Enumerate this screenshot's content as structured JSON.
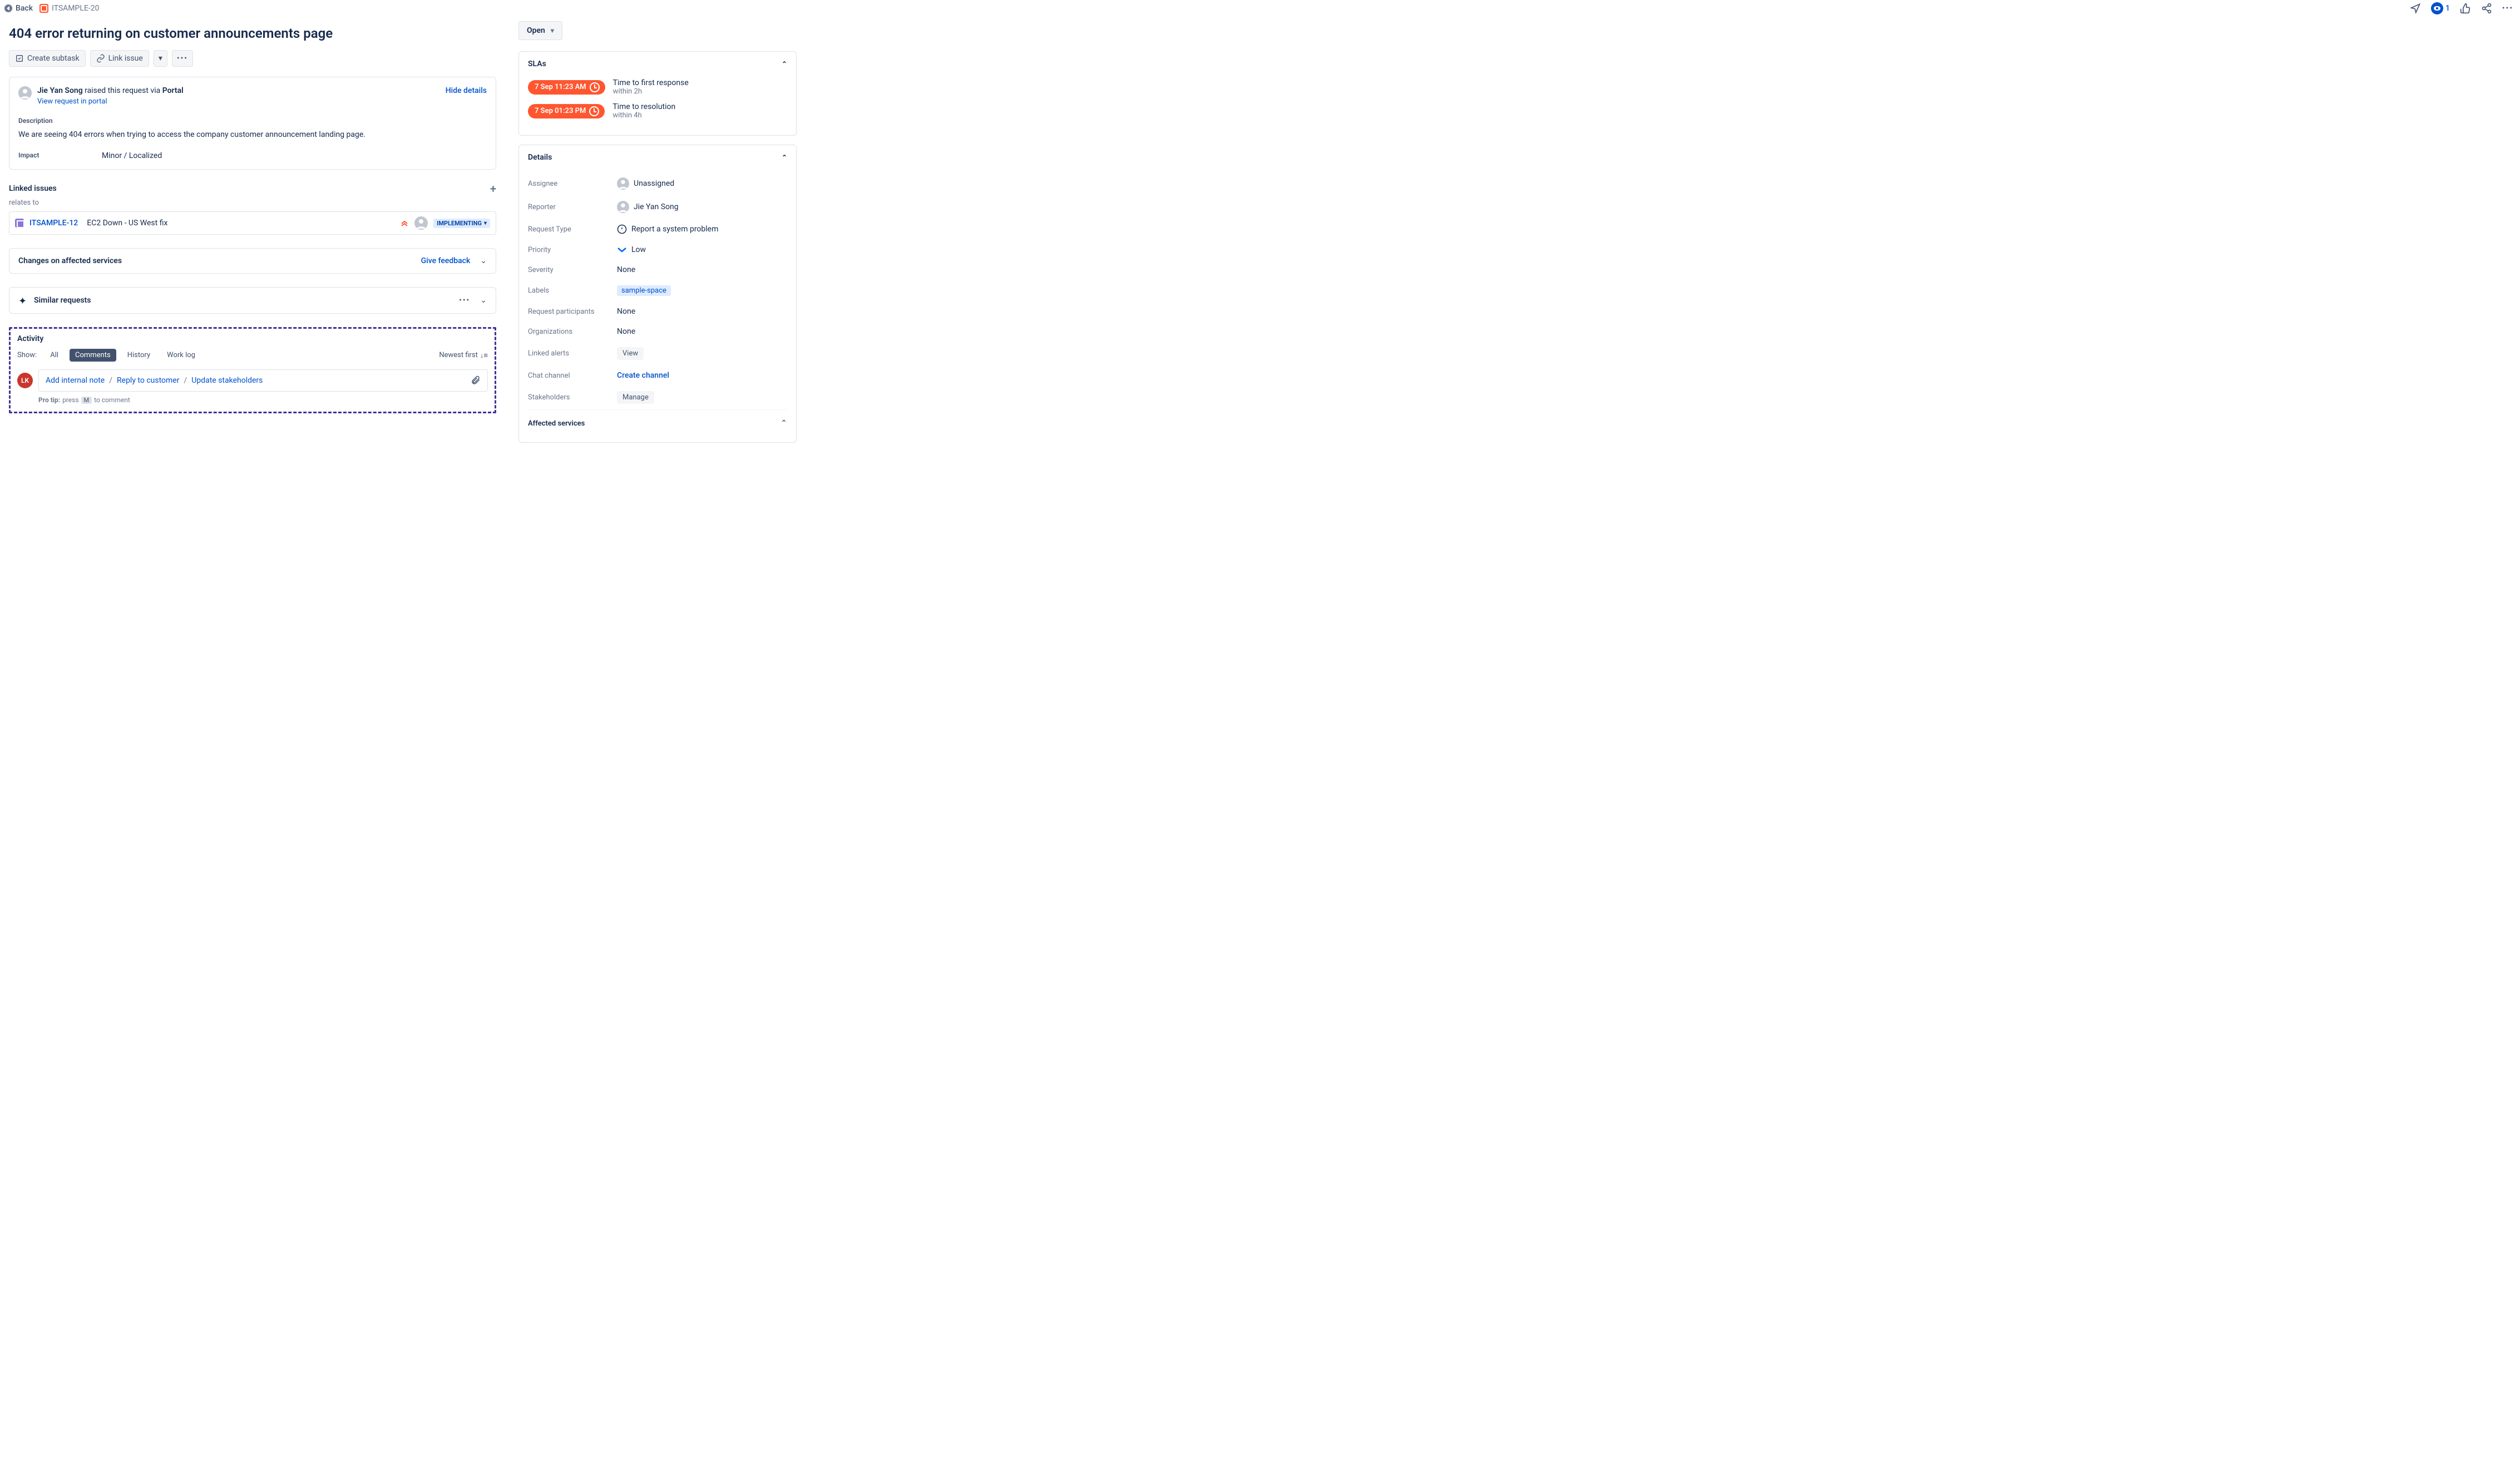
{
  "breadcrumb": {
    "back": "Back",
    "key": "ITSAMPLE-20"
  },
  "topbar": {
    "watch_count": "1"
  },
  "title": "404 error returning on customer announcements page",
  "toolbar": {
    "create_subtask": "Create subtask",
    "link_issue": "Link issue"
  },
  "request": {
    "author": "Jie Yan Song",
    "raised_via_pre": " raised this request via ",
    "raised_via_strong": "Portal",
    "hide_details": "Hide details",
    "view_portal": "View request in portal",
    "desc_label": "Description",
    "desc": "We are seeing 404 errors when trying to access the company customer announcement landing page.",
    "impact_label": "Impact",
    "impact_value": "Minor / Localized"
  },
  "linked": {
    "header": "Linked issues",
    "relation": "relates to",
    "items": [
      {
        "key": "ITSAMPLE-12",
        "title": "EC2 Down - US West fix",
        "status": "IMPLEMENTING"
      }
    ]
  },
  "changes": {
    "title": "Changes on affected services",
    "feedback": "Give feedback"
  },
  "similar": {
    "title": "Similar requests"
  },
  "activity": {
    "header": "Activity",
    "show_label": "Show:",
    "tabs": {
      "all": "All",
      "comments": "Comments",
      "history": "History",
      "worklog": "Work log"
    },
    "sort": "Newest first",
    "user_initials": "LK",
    "add_note": "Add internal note",
    "reply": "Reply to customer",
    "update": "Update stakeholders",
    "protip_label": "Pro tip:",
    "protip_pre": " press ",
    "protip_key": "M",
    "protip_post": " to comment"
  },
  "status": "Open",
  "slas": {
    "header": "SLAs",
    "items": [
      {
        "badge": "7 Sep 11:23 AM",
        "title": "Time to first response",
        "detail": "within 2h"
      },
      {
        "badge": "7 Sep 01:23 PM",
        "title": "Time to resolution",
        "detail": "within 4h"
      }
    ]
  },
  "details": {
    "header": "Details",
    "assignee_label": "Assignee",
    "assignee": "Unassigned",
    "reporter_label": "Reporter",
    "reporter": "Jie Yan Song",
    "reqtype_label": "Request Type",
    "reqtype": "Report a system problem",
    "priority_label": "Priority",
    "priority": "Low",
    "severity_label": "Severity",
    "severity": "None",
    "labels_label": "Labels",
    "labels": "sample-space",
    "reqpart_label": "Request participants",
    "reqpart": "None",
    "orgs_label": "Organizations",
    "orgs": "None",
    "alerts_label": "Linked alerts",
    "alerts_btn": "View",
    "chat_label": "Chat channel",
    "chat_link": "Create channel",
    "stake_label": "Stakeholders",
    "stake_btn": "Manage",
    "affected_label": "Affected services"
  }
}
